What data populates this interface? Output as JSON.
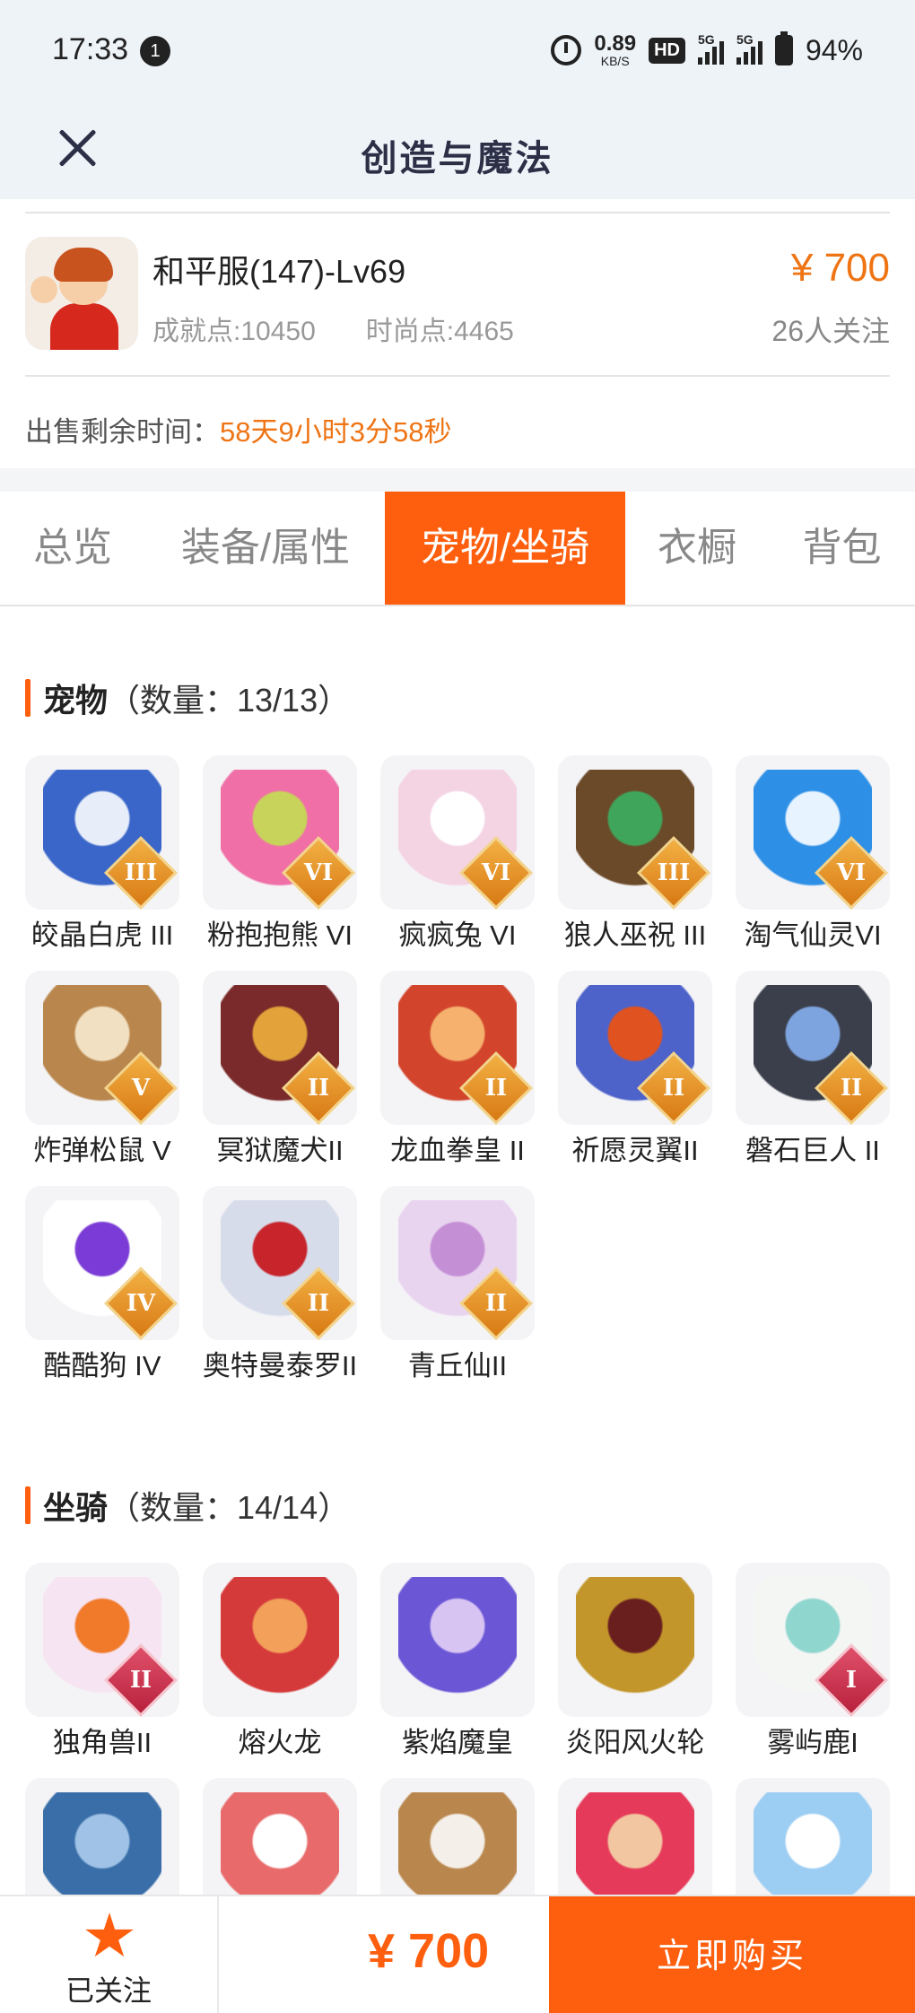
{
  "status": {
    "time": "17:33",
    "notif_count": "1",
    "net_speed": "0.89",
    "net_unit": "KB/S",
    "hd": "HD",
    "sim1": "5G",
    "sim2": "5G",
    "battery": "94%"
  },
  "header": {
    "title": "创造与魔法"
  },
  "account": {
    "name": "和平服(147)-Lv69",
    "achievement": "成就点:10450",
    "fashion": "时尚点:4465",
    "price": "¥ 700",
    "followers": "26人关注",
    "sale_label": "出售剩余时间：",
    "sale_time": "58天9小时3分58秒"
  },
  "tabs": [
    {
      "label": "总览"
    },
    {
      "label": "装备/属性"
    },
    {
      "label": "宠物/坐骑"
    },
    {
      "label": "衣橱"
    },
    {
      "label": "背包"
    }
  ],
  "pets": {
    "title": "宠物",
    "count": "（数量：13/13）",
    "items": [
      {
        "name": "皎晶白虎 III",
        "rank": "III"
      },
      {
        "name": "粉抱抱熊 VI",
        "rank": "VI"
      },
      {
        "name": "疯疯兔 VI",
        "rank": "VI"
      },
      {
        "name": "狼人巫祝 III",
        "rank": "III"
      },
      {
        "name": "淘气仙灵VI",
        "rank": "VI"
      },
      {
        "name": "炸弹松鼠 V",
        "rank": "V"
      },
      {
        "name": "冥狱魔犬II",
        "rank": "II"
      },
      {
        "name": "龙血拳皇 II",
        "rank": "II"
      },
      {
        "name": "祈愿灵翼II",
        "rank": "II"
      },
      {
        "name": "磐石巨人 II",
        "rank": "II"
      },
      {
        "name": "酷酷狗 IV",
        "rank": "IV"
      },
      {
        "name": "奥特曼泰罗II",
        "rank": "II"
      },
      {
        "name": "青丘仙II",
        "rank": "II"
      }
    ]
  },
  "mounts": {
    "title": "坐骑",
    "count": "（数量：14/14）",
    "items": [
      {
        "name": "独角兽II",
        "rank": "II"
      },
      {
        "name": "熔火龙",
        "rank": ""
      },
      {
        "name": "紫焰魔皇",
        "rank": ""
      },
      {
        "name": "炎阳风火轮",
        "rank": ""
      },
      {
        "name": "雾屿鹿I",
        "rank": "I"
      }
    ]
  },
  "bottom": {
    "follow_label": "已关注",
    "price": "¥ 700",
    "buy_label": "立即购买"
  }
}
